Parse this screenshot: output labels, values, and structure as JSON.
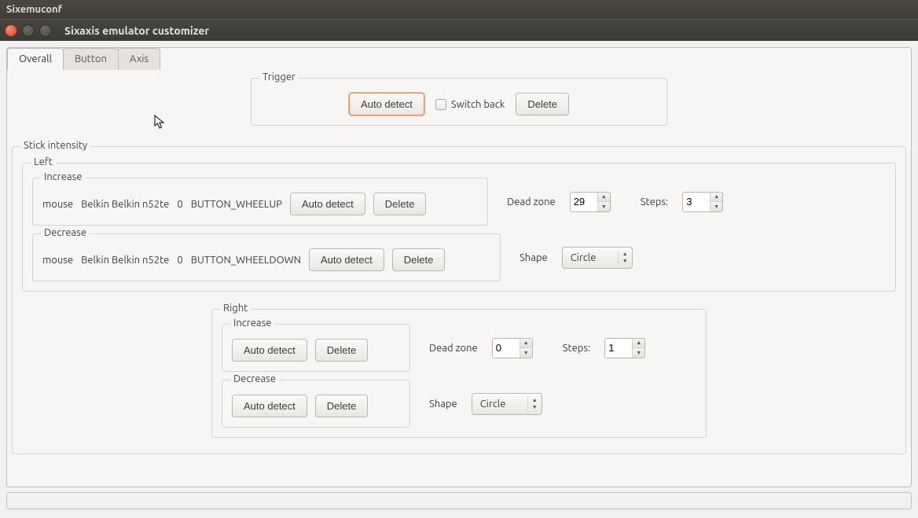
{
  "outer_title": "Sixemuconf",
  "window_title": "Sixaxis emulator customizer",
  "tabs": {
    "overall": "Overall",
    "button": "Button",
    "axis": "Axis"
  },
  "trigger": {
    "legend": "Trigger",
    "auto_detect": "Auto detect",
    "switch_back": "Switch back",
    "delete": "Delete"
  },
  "stick_intensity": {
    "legend": "Stick intensity",
    "left": {
      "legend": "Left",
      "increase": {
        "legend": "Increase",
        "type": "mouse",
        "device": "Belkin Belkin n52te",
        "index": "0",
        "id": "BUTTON_WHEELUP",
        "auto_detect": "Auto detect",
        "delete": "Delete"
      },
      "dead_zone_label": "Dead zone",
      "dead_zone_value": "29",
      "steps_label": "Steps:",
      "steps_value": "3",
      "decrease": {
        "legend": "Decrease",
        "type": "mouse",
        "device": "Belkin Belkin n52te",
        "index": "0",
        "id": "BUTTON_WHEELDOWN",
        "auto_detect": "Auto detect",
        "delete": "Delete"
      },
      "shape_label": "Shape",
      "shape_value": "Circle"
    },
    "right": {
      "legend": "Right",
      "increase": {
        "legend": "Increase",
        "auto_detect": "Auto detect",
        "delete": "Delete"
      },
      "dead_zone_label": "Dead zone",
      "dead_zone_value": "0",
      "steps_label": "Steps:",
      "steps_value": "1",
      "decrease": {
        "legend": "Decrease",
        "auto_detect": "Auto detect",
        "delete": "Delete"
      },
      "shape_label": "Shape",
      "shape_value": "Circle"
    }
  }
}
